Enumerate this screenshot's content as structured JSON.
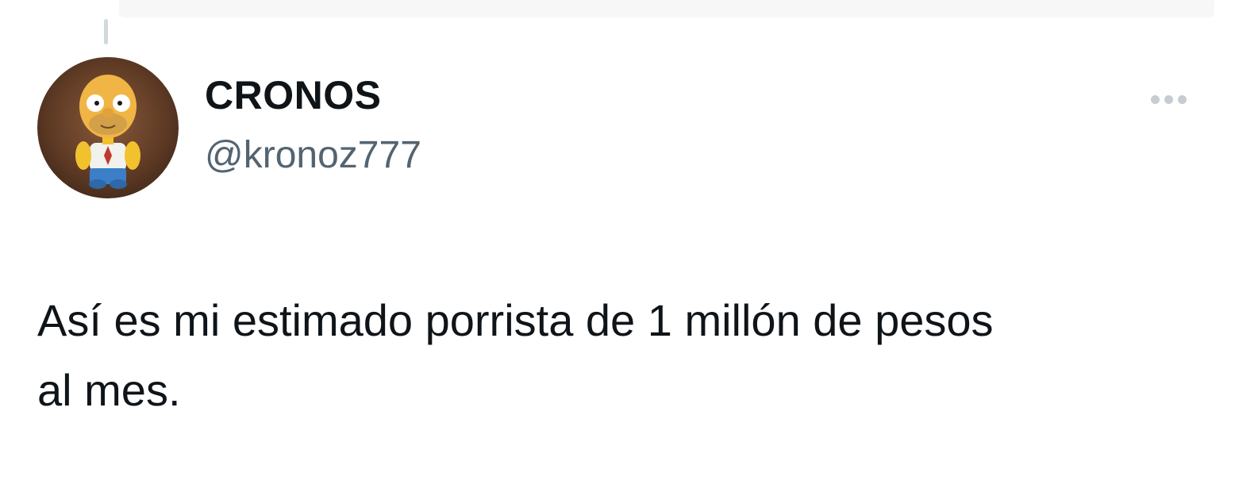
{
  "tweet": {
    "author": {
      "display_name": "CRONOS",
      "handle": "@kronoz777",
      "avatar_icon": "toy-figure-avatar"
    },
    "text": "Así es mi estimado porrista de 1 millón de pesos\nal mes.",
    "more_icon": "more-horizontal-icon"
  },
  "colors": {
    "text_primary": "#0f1419",
    "text_secondary": "#536471",
    "icon_muted": "#c5ccd2",
    "thread_line": "#cfd9de"
  }
}
